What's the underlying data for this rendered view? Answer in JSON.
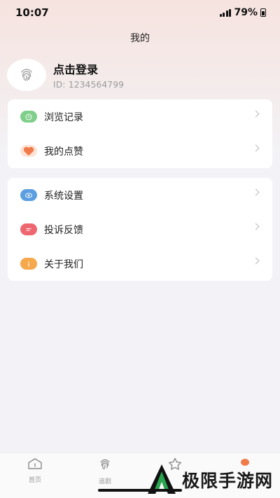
{
  "status": {
    "time": "10:07",
    "battery": "79%"
  },
  "header": {
    "title": "我的"
  },
  "profile": {
    "name": "点击登录",
    "id_text": "ID: 1234564799"
  },
  "group1": [
    {
      "label": "浏览记录",
      "icon": "clock-icon",
      "color": "#7fcf8a"
    },
    {
      "label": "我的点赞",
      "icon": "heart-icon",
      "color": "#f07a4a"
    }
  ],
  "group2": [
    {
      "label": "系统设置",
      "icon": "settings-icon",
      "color": "#5c9fe0"
    },
    {
      "label": "投诉反馈",
      "icon": "feedback-icon",
      "color": "#ee6670"
    },
    {
      "label": "关于我们",
      "icon": "info-icon",
      "color": "#f5a84c"
    }
  ],
  "tabbar": {
    "tabs": [
      {
        "label": "首页",
        "icon": "home-icon"
      },
      {
        "label": "追剧",
        "icon": "fingerprint-icon"
      },
      {
        "label": "",
        "icon": "star-icon"
      },
      {
        "label": "",
        "icon": "profile-dot-icon",
        "color": "#f07a4a"
      }
    ]
  },
  "watermark": {
    "text": "极限手游网"
  }
}
